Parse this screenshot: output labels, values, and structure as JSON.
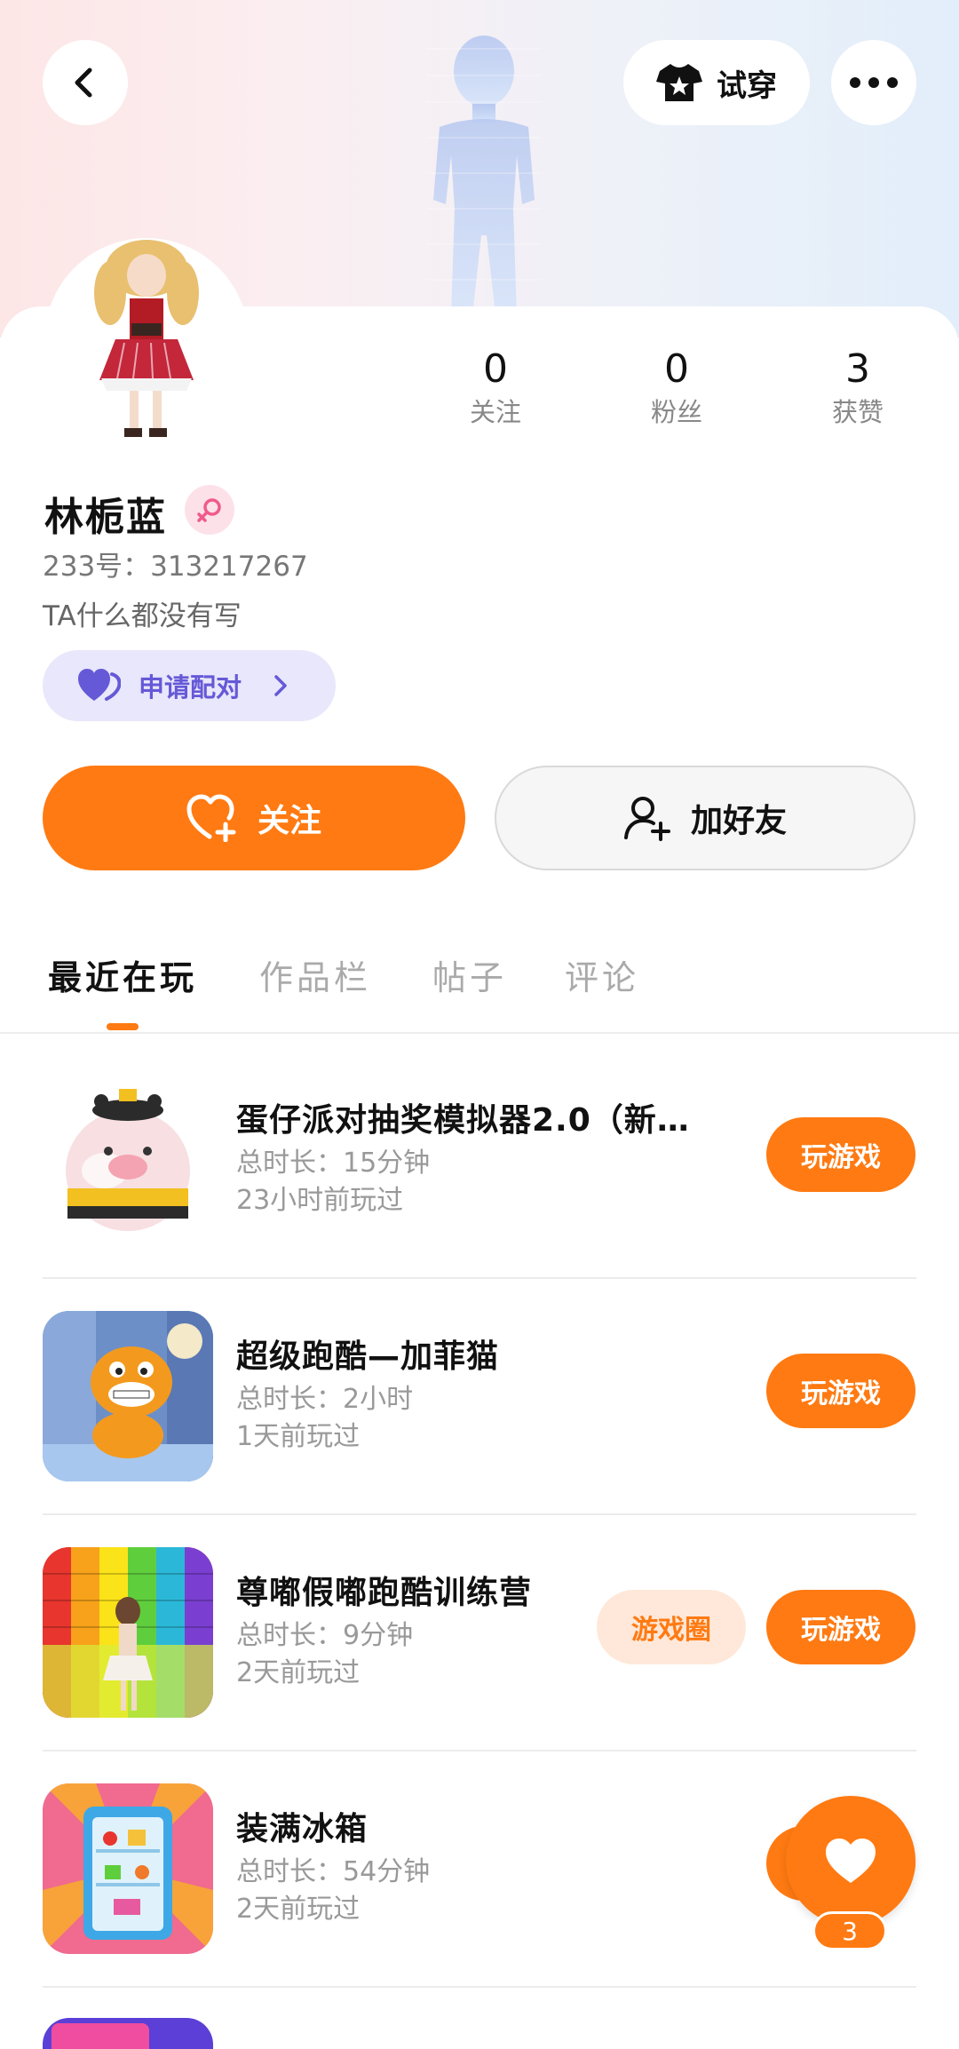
{
  "header": {
    "back_icon": "chevron-left-icon",
    "try_on_label": "试穿",
    "try_on_icon": "shirt-star-icon",
    "more_icon": "ellipsis-icon"
  },
  "stats": [
    {
      "value": "0",
      "label": "关注"
    },
    {
      "value": "0",
      "label": "粉丝"
    },
    {
      "value": "3",
      "label": "获赞"
    }
  ],
  "profile": {
    "name": "林栀蓝",
    "gender_icon": "female-icon",
    "uid": "233号：313217267",
    "bio": "TA什么都没有写",
    "pair_label": "申请配对",
    "pair_icon": "heart-pair-icon"
  },
  "actions": {
    "follow_label": "关注",
    "add_friend_label": "加好友"
  },
  "tabs": [
    "最近在玩",
    "作品栏",
    "帖子",
    "评论"
  ],
  "games": [
    {
      "title": "蛋仔派对抽奖模拟器2.0（新…",
      "duration": "总时长：15分钟",
      "last_played": "23小时前玩过",
      "play_label": "玩游戏"
    },
    {
      "title": "超级跑酷—加菲猫",
      "duration": "总时长：2小时",
      "last_played": "1天前玩过",
      "play_label": "玩游戏"
    },
    {
      "title": "尊嘟假嘟跑酷训练营",
      "duration": "总时长：9分钟",
      "last_played": "2天前玩过",
      "play_label": "玩游戏",
      "circle_label": "游戏圈"
    },
    {
      "title": "装满冰箱",
      "duration": "总时长：54分钟",
      "last_played": "2天前玩过",
      "play_label": "玩游戏"
    }
  ],
  "fab": {
    "icon": "heart-icon",
    "count": "3"
  },
  "colors": {
    "accent": "#ff7a12",
    "pair": "#6559d7",
    "pair_bg": "#e8e7fb"
  }
}
